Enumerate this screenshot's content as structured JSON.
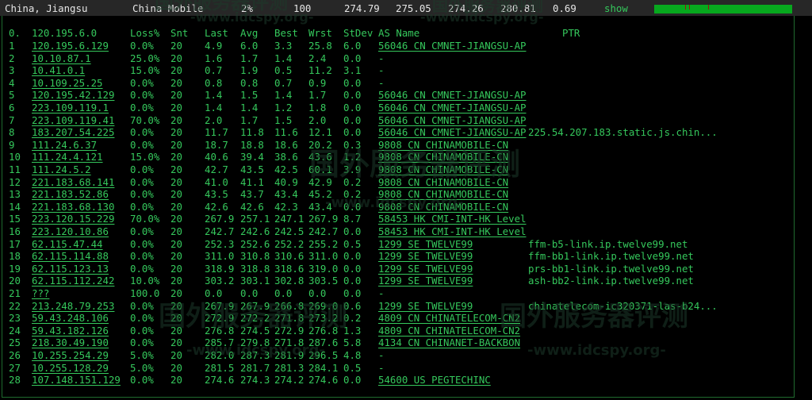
{
  "topbar": {
    "location": "China, Jiangsu",
    "isp": "China Mobile",
    "loss": "2%",
    "count": "100",
    "last": "274.79",
    "avg": "275.05",
    "best": "274.26",
    "worst": "280.81",
    "stdev": "0.69",
    "show_label": "show"
  },
  "headers": {
    "idx": "0.",
    "host": "120.195.6.0",
    "loss": "Loss%",
    "snt": "Snt",
    "last": "Last",
    "avg": "Avg",
    "best": "Best",
    "wrst": "Wrst",
    "stdev": "StDev",
    "as": "AS Name",
    "ptr": "PTR"
  },
  "hops": [
    {
      "idx": "1",
      "host": "120.195.6.129",
      "loss": "0.0%",
      "snt": "20",
      "last": "4.9",
      "avg": "6.0",
      "best": "3.3",
      "wrst": "25.8",
      "stdev": "6.0",
      "as": "56046 CN CMNET-JIANGSU-AP",
      "ptr": ""
    },
    {
      "idx": "2",
      "host": "10.10.87.1",
      "loss": "25.0%",
      "snt": "20",
      "last": "1.6",
      "avg": "1.7",
      "best": "1.4",
      "wrst": "2.4",
      "stdev": "0.0",
      "as": "-",
      "ptr": ""
    },
    {
      "idx": "3",
      "host": "10.41.0.1",
      "loss": "15.0%",
      "snt": "20",
      "last": "0.7",
      "avg": "1.9",
      "best": "0.5",
      "wrst": "11.2",
      "stdev": "3.1",
      "as": "-",
      "ptr": ""
    },
    {
      "idx": "4",
      "host": "10.109.25.25",
      "loss": "0.0%",
      "snt": "20",
      "last": "0.8",
      "avg": "0.8",
      "best": "0.7",
      "wrst": "0.9",
      "stdev": "0.0",
      "as": "-",
      "ptr": ""
    },
    {
      "idx": "5",
      "host": "120.195.42.129",
      "loss": "0.0%",
      "snt": "20",
      "last": "1.4",
      "avg": "1.5",
      "best": "1.4",
      "wrst": "1.7",
      "stdev": "0.0",
      "as": "56046 CN CMNET-JIANGSU-AP",
      "ptr": ""
    },
    {
      "idx": "6",
      "host": "223.109.119.1",
      "loss": "0.0%",
      "snt": "20",
      "last": "1.4",
      "avg": "1.4",
      "best": "1.2",
      "wrst": "1.8",
      "stdev": "0.0",
      "as": "56046 CN CMNET-JIANGSU-AP",
      "ptr": ""
    },
    {
      "idx": "7",
      "host": "223.109.119.41",
      "loss": "70.0%",
      "snt": "20",
      "last": "2.0",
      "avg": "1.7",
      "best": "1.5",
      "wrst": "2.0",
      "stdev": "0.0",
      "as": "56046 CN CMNET-JIANGSU-AP",
      "ptr": ""
    },
    {
      "idx": "8",
      "host": "183.207.54.225",
      "loss": "0.0%",
      "snt": "20",
      "last": "11.7",
      "avg": "11.8",
      "best": "11.6",
      "wrst": "12.1",
      "stdev": "0.0",
      "as": "56046 CN CMNET-JIANGSU-AP",
      "ptr": "225.54.207.183.static.js.chin..."
    },
    {
      "idx": "9",
      "host": "111.24.6.37",
      "loss": "0.0%",
      "snt": "20",
      "last": "18.7",
      "avg": "18.8",
      "best": "18.6",
      "wrst": "20.2",
      "stdev": "0.3",
      "as": "9808  CN CHINAMOBILE-CN",
      "ptr": ""
    },
    {
      "idx": "10",
      "host": "111.24.4.121",
      "loss": "15.0%",
      "snt": "20",
      "last": "40.6",
      "avg": "39.4",
      "best": "38.6",
      "wrst": "43.6",
      "stdev": "1.2",
      "as": "9808  CN CHINAMOBILE-CN",
      "ptr": ""
    },
    {
      "idx": "11",
      "host": "111.24.5.2",
      "loss": "0.0%",
      "snt": "20",
      "last": "42.7",
      "avg": "43.5",
      "best": "42.5",
      "wrst": "60.1",
      "stdev": "3.9",
      "as": "9808  CN CHINAMOBILE-CN",
      "ptr": ""
    },
    {
      "idx": "12",
      "host": "221.183.68.141",
      "loss": "0.0%",
      "snt": "20",
      "last": "41.0",
      "avg": "41.1",
      "best": "40.9",
      "wrst": "42.9",
      "stdev": "0.2",
      "as": "9808  CN CHINAMOBILE-CN",
      "ptr": ""
    },
    {
      "idx": "13",
      "host": "221.183.52.86",
      "loss": "0.0%",
      "snt": "20",
      "last": "43.5",
      "avg": "43.7",
      "best": "43.4",
      "wrst": "45.2",
      "stdev": "0.2",
      "as": "9808  CN CHINAMOBILE-CN",
      "ptr": ""
    },
    {
      "idx": "14",
      "host": "221.183.68.130",
      "loss": "0.0%",
      "snt": "20",
      "last": "42.6",
      "avg": "42.6",
      "best": "42.3",
      "wrst": "43.4",
      "stdev": "0.0",
      "as": "9808  CN CHINAMOBILE-CN",
      "ptr": ""
    },
    {
      "idx": "15",
      "host": "223.120.15.229",
      "loss": "70.0%",
      "snt": "20",
      "last": "267.9",
      "avg": "257.1",
      "best": "247.1",
      "wrst": "267.9",
      "stdev": "8.7",
      "as": "58453 HK CMI-INT-HK Level",
      "ptr": ""
    },
    {
      "idx": "16",
      "host": "223.120.10.86",
      "loss": "0.0%",
      "snt": "20",
      "last": "242.7",
      "avg": "242.6",
      "best": "242.5",
      "wrst": "242.7",
      "stdev": "0.0",
      "as": "58453 HK CMI-INT-HK Level",
      "ptr": ""
    },
    {
      "idx": "17",
      "host": "62.115.47.44",
      "loss": "0.0%",
      "snt": "20",
      "last": "252.3",
      "avg": "252.6",
      "best": "252.2",
      "wrst": "255.2",
      "stdev": "0.5",
      "as": "1299  SE TWELVE99",
      "ptr": "ffm-b5-link.ip.twelve99.net"
    },
    {
      "idx": "18",
      "host": "62.115.114.88",
      "loss": "0.0%",
      "snt": "20",
      "last": "311.0",
      "avg": "310.8",
      "best": "310.6",
      "wrst": "311.0",
      "stdev": "0.0",
      "as": "1299  SE TWELVE99",
      "ptr": "ffm-bb1-link.ip.twelve99.net"
    },
    {
      "idx": "19",
      "host": "62.115.123.13",
      "loss": "0.0%",
      "snt": "20",
      "last": "318.9",
      "avg": "318.8",
      "best": "318.6",
      "wrst": "319.0",
      "stdev": "0.0",
      "as": "1299  SE TWELVE99",
      "ptr": "prs-bb1-link.ip.twelve99.net"
    },
    {
      "idx": "20",
      "host": "62.115.112.242",
      "loss": "10.0%",
      "snt": "20",
      "last": "303.2",
      "avg": "303.1",
      "best": "302.8",
      "wrst": "303.5",
      "stdev": "0.0",
      "as": "1299  SE TWELVE99",
      "ptr": "ash-bb2-link.ip.twelve99.net"
    },
    {
      "idx": "21",
      "host": "???",
      "loss": "100.0",
      "snt": "20",
      "last": "0.0",
      "avg": "0.0",
      "best": "0.0",
      "wrst": "0.0",
      "stdev": "0.0",
      "as": "-",
      "ptr": ""
    },
    {
      "idx": "22",
      "host": "213.248.79.253",
      "loss": "0.0%",
      "snt": "20",
      "last": "267.9",
      "avg": "267.9",
      "best": "266.8",
      "wrst": "269.0",
      "stdev": "0.6",
      "as": "1299  SE TWELVE99",
      "ptr": "chinatelecom-ic320371-las-b24..."
    },
    {
      "idx": "23",
      "host": "59.43.248.106",
      "loss": "0.0%",
      "snt": "20",
      "last": "272.9",
      "avg": "272.2",
      "best": "271.8",
      "wrst": "273.2",
      "stdev": "0.2",
      "as": "4809  CN CHINATELECOM-CN2",
      "ptr": ""
    },
    {
      "idx": "24",
      "host": "59.43.182.126",
      "loss": "0.0%",
      "snt": "20",
      "last": "276.8",
      "avg": "274.5",
      "best": "272.9",
      "wrst": "276.8",
      "stdev": "1.3",
      "as": "4809  CN CHINATELECOM-CN2",
      "ptr": ""
    },
    {
      "idx": "25",
      "host": "218.30.49.190",
      "loss": "0.0%",
      "snt": "20",
      "last": "285.7",
      "avg": "279.8",
      "best": "271.8",
      "wrst": "287.6",
      "stdev": "5.8",
      "as": "4134  CN CHINANET-BACKBON",
      "ptr": ""
    },
    {
      "idx": "26",
      "host": "10.255.254.29",
      "loss": "5.0%",
      "snt": "20",
      "last": "282.0",
      "avg": "287.3",
      "best": "281.9",
      "wrst": "296.5",
      "stdev": "4.8",
      "as": "-",
      "ptr": ""
    },
    {
      "idx": "27",
      "host": "10.255.128.29",
      "loss": "5.0%",
      "snt": "20",
      "last": "281.5",
      "avg": "281.7",
      "best": "281.3",
      "wrst": "284.1",
      "stdev": "0.5",
      "as": "-",
      "ptr": ""
    },
    {
      "idx": "28",
      "host": "107.148.151.129",
      "loss": "0.0%",
      "snt": "20",
      "last": "274.6",
      "avg": "274.3",
      "best": "274.2",
      "wrst": "274.6",
      "stdev": "0.0",
      "as": "54600 US PEGTECHINC",
      "ptr": ""
    }
  ],
  "watermarks": {
    "cn_text": "国外服务器评测",
    "url": "-www.idcspy.org-"
  },
  "colors": {
    "text": "#35c85c",
    "background": "#000000",
    "topbar": "#272727",
    "graph": "#07a81e",
    "graph_tick": "#9e1111"
  }
}
